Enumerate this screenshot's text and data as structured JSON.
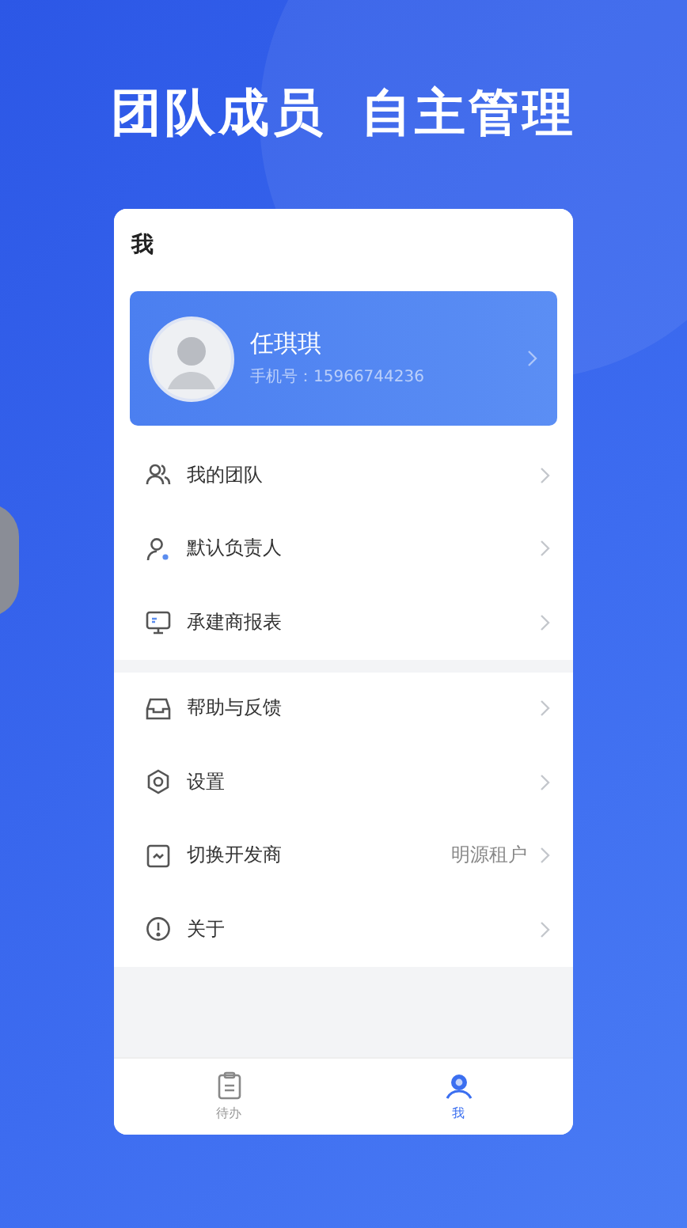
{
  "headline": [
    "团队成员",
    "自主管理"
  ],
  "screen": {
    "title": "我",
    "profile": {
      "name": "任琪琪",
      "phone": "手机号：15966744236"
    },
    "menu_groups": [
      [
        {
          "label": "我的团队"
        },
        {
          "label": "默认负责人"
        },
        {
          "label": "承建商报表"
        }
      ],
      [
        {
          "label": "帮助与反馈"
        },
        {
          "label": "设置"
        },
        {
          "label": "切换开发商",
          "value": "明源租户"
        },
        {
          "label": "关于"
        }
      ]
    ]
  },
  "tabs": [
    {
      "label": "待办",
      "selected": false
    },
    {
      "label": "我",
      "selected": true
    }
  ]
}
